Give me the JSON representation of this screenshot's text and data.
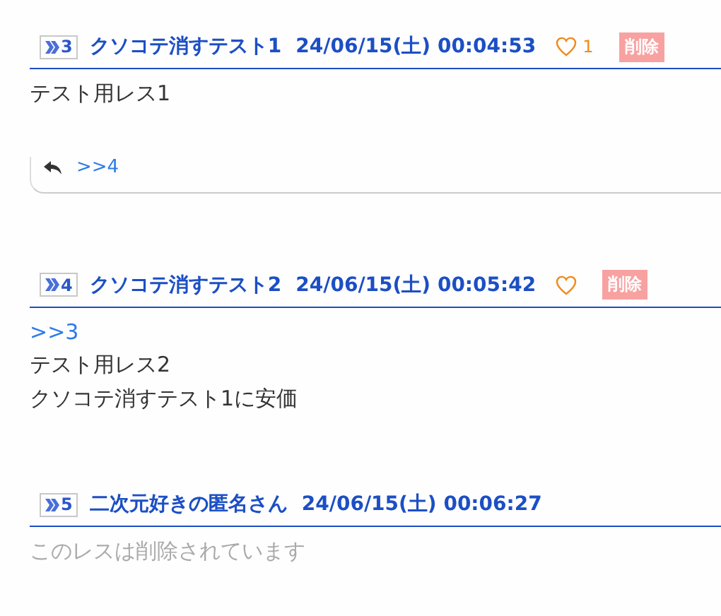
{
  "posts": [
    {
      "number": "3",
      "name": "クソコテ消すテスト1",
      "date": "24/06/15(土) 00:04:53",
      "likeable": true,
      "like_count": "1",
      "delete_label": "削除",
      "body": [
        {
          "kind": "text",
          "text": "テスト用レス1"
        }
      ],
      "replies": [
        ">>4"
      ]
    },
    {
      "number": "4",
      "name": "クソコテ消すテスト2",
      "date": "24/06/15(土) 00:05:42",
      "likeable": true,
      "delete_label": "削除",
      "body": [
        {
          "kind": "anchor",
          "text": ">>3"
        },
        {
          "kind": "text",
          "text": "テスト用レス2"
        },
        {
          "kind": "text",
          "text": "クソコテ消すテスト1に安価"
        }
      ]
    },
    {
      "number": "5",
      "name": "二次元好きの匿名さん",
      "date": "24/06/15(土) 00:06:27",
      "likeable": false,
      "body": [
        {
          "kind": "deleted",
          "text": "このレスは削除されています"
        }
      ]
    }
  ]
}
